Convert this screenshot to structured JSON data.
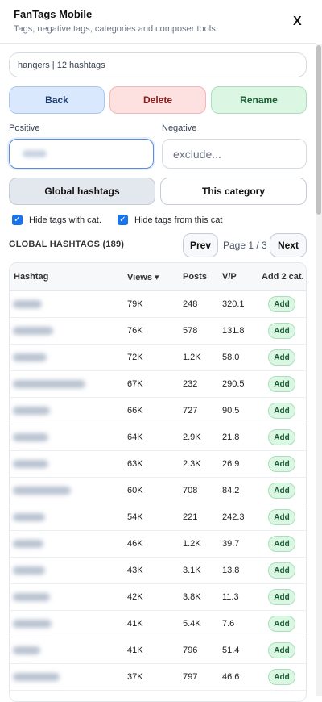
{
  "app": {
    "title": "FanTags Mobile",
    "subtitle": "Tags, negative tags, categories and composer tools.",
    "close_label": "X"
  },
  "category_selector": {
    "value": "hangers | 12 hashtags"
  },
  "actions": {
    "back": "Back",
    "delete": "Delete",
    "rename": "Rename"
  },
  "fields": {
    "positive_label": "Positive",
    "negative_label": "Negative",
    "negative_placeholder": "exclude..."
  },
  "scope": {
    "global": "Global hashtags",
    "category": "This category"
  },
  "filters": {
    "hide_with_cat": {
      "label": "Hide tags with cat.",
      "checked": true
    },
    "hide_from_this": {
      "label": "Hide tags from this cat",
      "checked": true
    }
  },
  "list": {
    "section_title": "GLOBAL HASHTAGS (189)",
    "prev": "Prev",
    "next": "Next",
    "page_info": "Page 1 / 3",
    "headers": {
      "hashtag": "Hashtag",
      "views": "Views ▾",
      "posts": "Posts",
      "vp": "V/P",
      "add": "Add 2 cat."
    },
    "add_label": "Add",
    "rows": [
      {
        "views": "79K",
        "posts": "248",
        "vp": "320.1"
      },
      {
        "views": "76K",
        "posts": "578",
        "vp": "131.8"
      },
      {
        "views": "72K",
        "posts": "1.2K",
        "vp": "58.0"
      },
      {
        "views": "67K",
        "posts": "232",
        "vp": "290.5"
      },
      {
        "views": "66K",
        "posts": "727",
        "vp": "90.5"
      },
      {
        "views": "64K",
        "posts": "2.9K",
        "vp": "21.8"
      },
      {
        "views": "63K",
        "posts": "2.3K",
        "vp": "26.9"
      },
      {
        "views": "60K",
        "posts": "708",
        "vp": "84.2"
      },
      {
        "views": "54K",
        "posts": "221",
        "vp": "242.3"
      },
      {
        "views": "46K",
        "posts": "1.2K",
        "vp": "39.7"
      },
      {
        "views": "43K",
        "posts": "3.1K",
        "vp": "13.8"
      },
      {
        "views": "42K",
        "posts": "3.8K",
        "vp": "11.3"
      },
      {
        "views": "41K",
        "posts": "5.4K",
        "vp": "7.6"
      },
      {
        "views": "41K",
        "posts": "796",
        "vp": "51.4"
      },
      {
        "views": "37K",
        "posts": "797",
        "vp": "46.6"
      }
    ]
  }
}
